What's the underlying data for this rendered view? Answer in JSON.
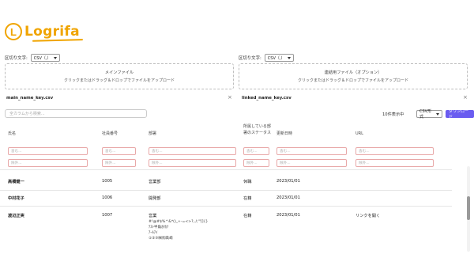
{
  "app": {
    "logo_letter": "L",
    "logo_text": "Logrifa"
  },
  "left_panel": {
    "delimiter_label": "区切り文字:",
    "delimiter_value": "CSV（,）",
    "dropzone_title": "メインファイル",
    "dropzone_sub": "クリックまたはドラッグ＆ドロップでファイルをアップロード",
    "file_name": "main_name_key.csv"
  },
  "right_panel": {
    "delimiter_label": "区切り文字:",
    "delimiter_value": "CSV（,）",
    "dropzone_title": "連結用ファイル（オプション）",
    "dropzone_sub": "クリックまたはドラッグ＆ドロップでファイルをアップロード",
    "file_name": "linked_name_key.csv"
  },
  "toolbar": {
    "search_placeholder": "全カラムから検索...",
    "row_count": "10件表示中",
    "format_value": "CSV形式",
    "download_label": "ダウンロード"
  },
  "table": {
    "headers": [
      "氏名",
      "社員番号",
      "部署",
      "所属している部署のステータス",
      "更新日時",
      "URL"
    ],
    "filter_placeholder_1": "含む...",
    "filter_placeholder_2": "除外...",
    "rows": [
      {
        "name": "高橋健一",
        "id": "1005",
        "dept": "営業部",
        "status": "休職",
        "updated": "2023/01/01",
        "url": ""
      },
      {
        "name": "中村花子",
        "id": "1006",
        "dept": "開発部",
        "status": "在籍",
        "updated": "2023/01/01",
        "url": ""
      },
      {
        "name": "渡辺正実",
        "id": "1007",
        "dept": "営業",
        "status": "在籍",
        "updated": "2023/01/01",
        "url": "リンクを開く",
        "dept_extra": [
          "#!@#$%^&*()_+-=<>?,./;'\"[]{}",
          "ﾃｽﾄ半角ｶﾀｶﾅ",
          "ｱｰﾙｱｲ",
          "①②③㈱㈲髙﨑"
        ]
      }
    ]
  },
  "colors": {
    "accent": "#f0a400",
    "primary_button": "#6a5cf0",
    "filter_border": "#e8a8a8"
  }
}
